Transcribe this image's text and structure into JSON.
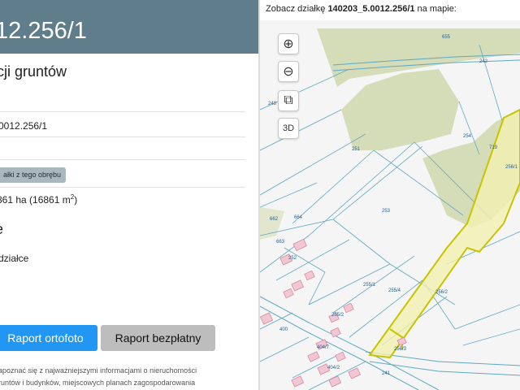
{
  "header": {
    "title": "12.256/1"
  },
  "panel": {
    "section_title": "cji gruntów",
    "parcel_id": "0012.256/1",
    "badge": "ałki z tego obrębu",
    "area_main": "861 ha (16861 m",
    "area_sup": "2",
    "area_close": ")",
    "heading2": "e",
    "info": "działce",
    "btn_ortho": "Raport ortofoto",
    "btn_free": "Raport bezpłatny",
    "note_line1": "apoznać się z najważniejszymi informacjami o nieruchomości",
    "note_line2": "runtów i budynków, miejscowych planach zagospodarowania"
  },
  "map": {
    "header_prefix": "Zobacz działkę ",
    "header_parcel": "140203_5.0012.256/1",
    "header_suffix": " na mapie:",
    "controls": {
      "zoom_in": "⊕",
      "zoom_out": "⊖",
      "layers": "⧉",
      "view3d": "3D"
    },
    "labels": [
      "655",
      "242",
      "248",
      "251",
      "254",
      "719",
      "256/1",
      "253",
      "662",
      "664",
      "663",
      "252",
      "255/1",
      "255/4",
      "256/2",
      "255/2",
      "256/3",
      "400",
      "404/7",
      "404/2",
      "241"
    ],
    "colors": {
      "parcel_outline": "#c8c400",
      "parcel_fill": "#f3f0b0",
      "forest": "#d5dcb8",
      "lines": "#5fa9c4",
      "buildings": "#d98b9e"
    }
  }
}
